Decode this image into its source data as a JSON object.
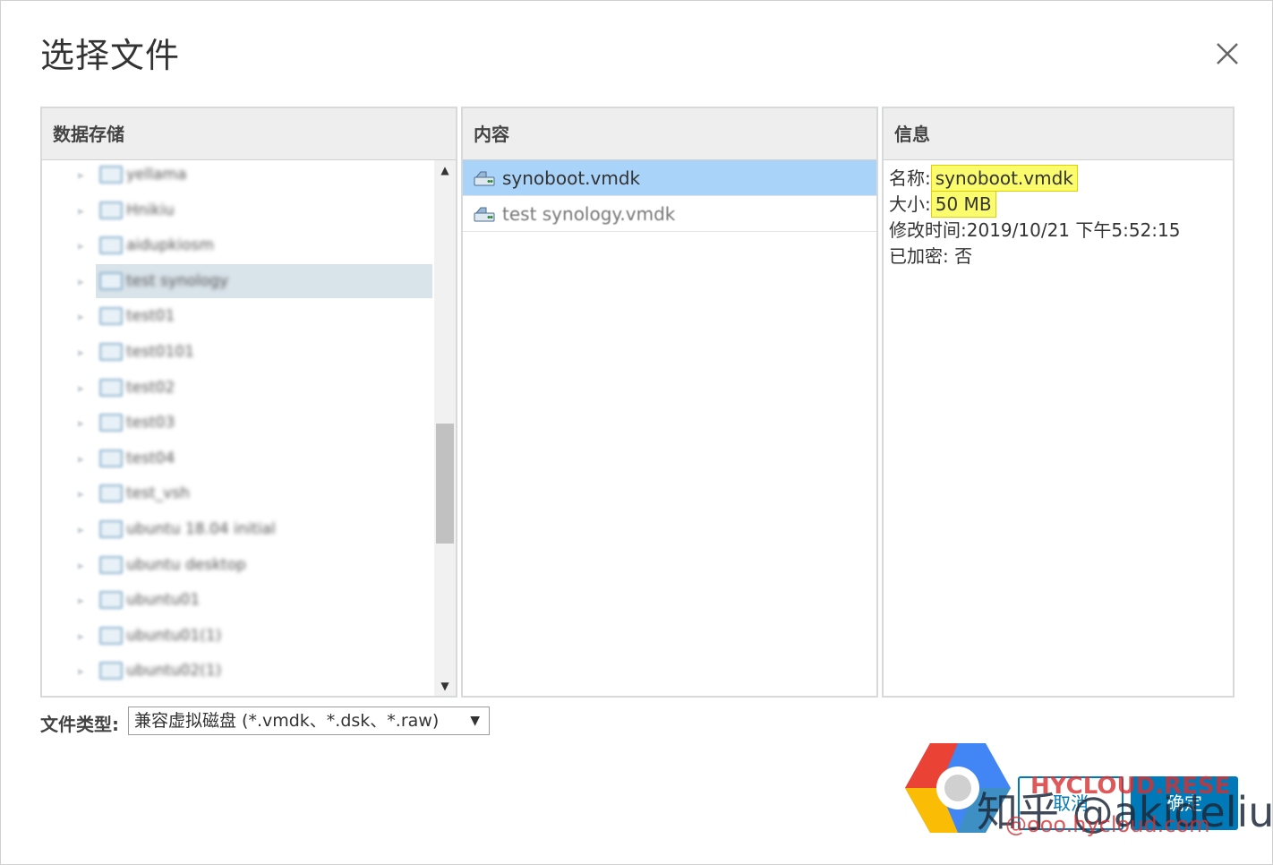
{
  "dialog": {
    "title": "选择文件"
  },
  "datastore": {
    "header": "数据存储",
    "items": [
      {
        "label": "yellama"
      },
      {
        "label": "Hnikiu"
      },
      {
        "label": "aidupkiosm"
      },
      {
        "label": "test synology"
      },
      {
        "label": "test01"
      },
      {
        "label": "test0101"
      },
      {
        "label": "test02"
      },
      {
        "label": "test03"
      },
      {
        "label": "test04"
      },
      {
        "label": "test_vsh"
      },
      {
        "label": "ubuntu 18.04 initial"
      },
      {
        "label": "ubuntu desktop"
      },
      {
        "label": "ubuntu01"
      },
      {
        "label": "ubuntu01(1)"
      },
      {
        "label": "ubuntu02(1)"
      }
    ],
    "selected_index": 3
  },
  "content": {
    "header": "内容",
    "files": [
      {
        "label": "synoboot.vmdk",
        "selected": true
      },
      {
        "label": "test synology.vmdk",
        "selected": false
      }
    ]
  },
  "info": {
    "header": "信息",
    "name_label": "名称:",
    "name_value": "synoboot.vmdk",
    "size_label": "大小:",
    "size_value": "50 MB",
    "modified_label": "修改时间:",
    "modified_value": "2019/10/21 下午5:52:15",
    "encrypted_label": "已加密:",
    "encrypted_value": "否"
  },
  "filetype": {
    "label": "文件类型:",
    "selected": "兼容虚拟磁盘 (*.vmdk、*.dsk、*.raw)"
  },
  "buttons": {
    "cancel": "取消",
    "ok": "确定"
  },
  "watermark": {
    "text": "知乎 @akideliu",
    "brand": "HYCLOUD.RESE",
    "brand_url": "@ooo.hycloud.com"
  },
  "colors": {
    "accent": "#0079b8",
    "selected_row": "#a9d3f8",
    "highlight": "#fbfb6e",
    "header_bg": "#eeeeee"
  }
}
